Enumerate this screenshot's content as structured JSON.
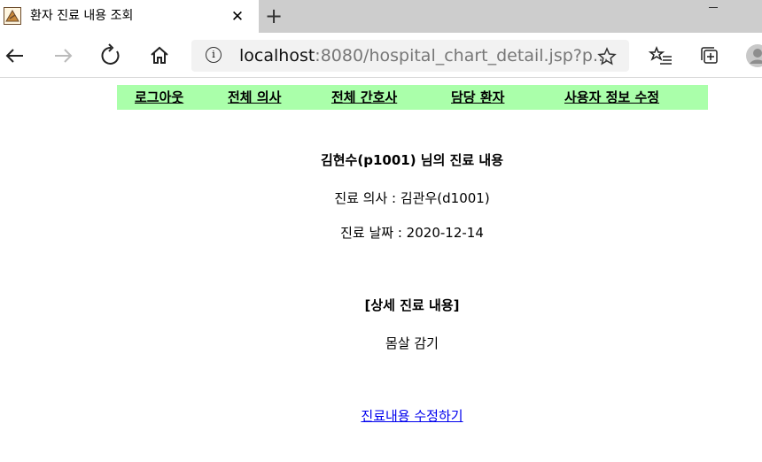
{
  "browser": {
    "tab_title": "환자 진료 내용 조회",
    "url_host": "localhost",
    "url_rest": ":8080/hospital_chart_detail.jsp?p..."
  },
  "nav": {
    "items": [
      {
        "label": "로그아웃"
      },
      {
        "label": "전체 의사"
      },
      {
        "label": "전체 간호사"
      },
      {
        "label": "담당 환자"
      },
      {
        "label": "사용자 정보 수정"
      }
    ]
  },
  "chart": {
    "heading": "김현수(p1001) 님의 진료 내용",
    "doctor_line": "진료 의사 : 김관우(d1001)",
    "date_line": "진료 날짜 : 2020-12-14",
    "detail_title": "[상세 진료 내용]",
    "detail_body": "몸살 감기",
    "edit_link": "진료내용 수정하기"
  },
  "colors": {
    "nav_background": "#aaffaa",
    "link": "#0000ee"
  }
}
